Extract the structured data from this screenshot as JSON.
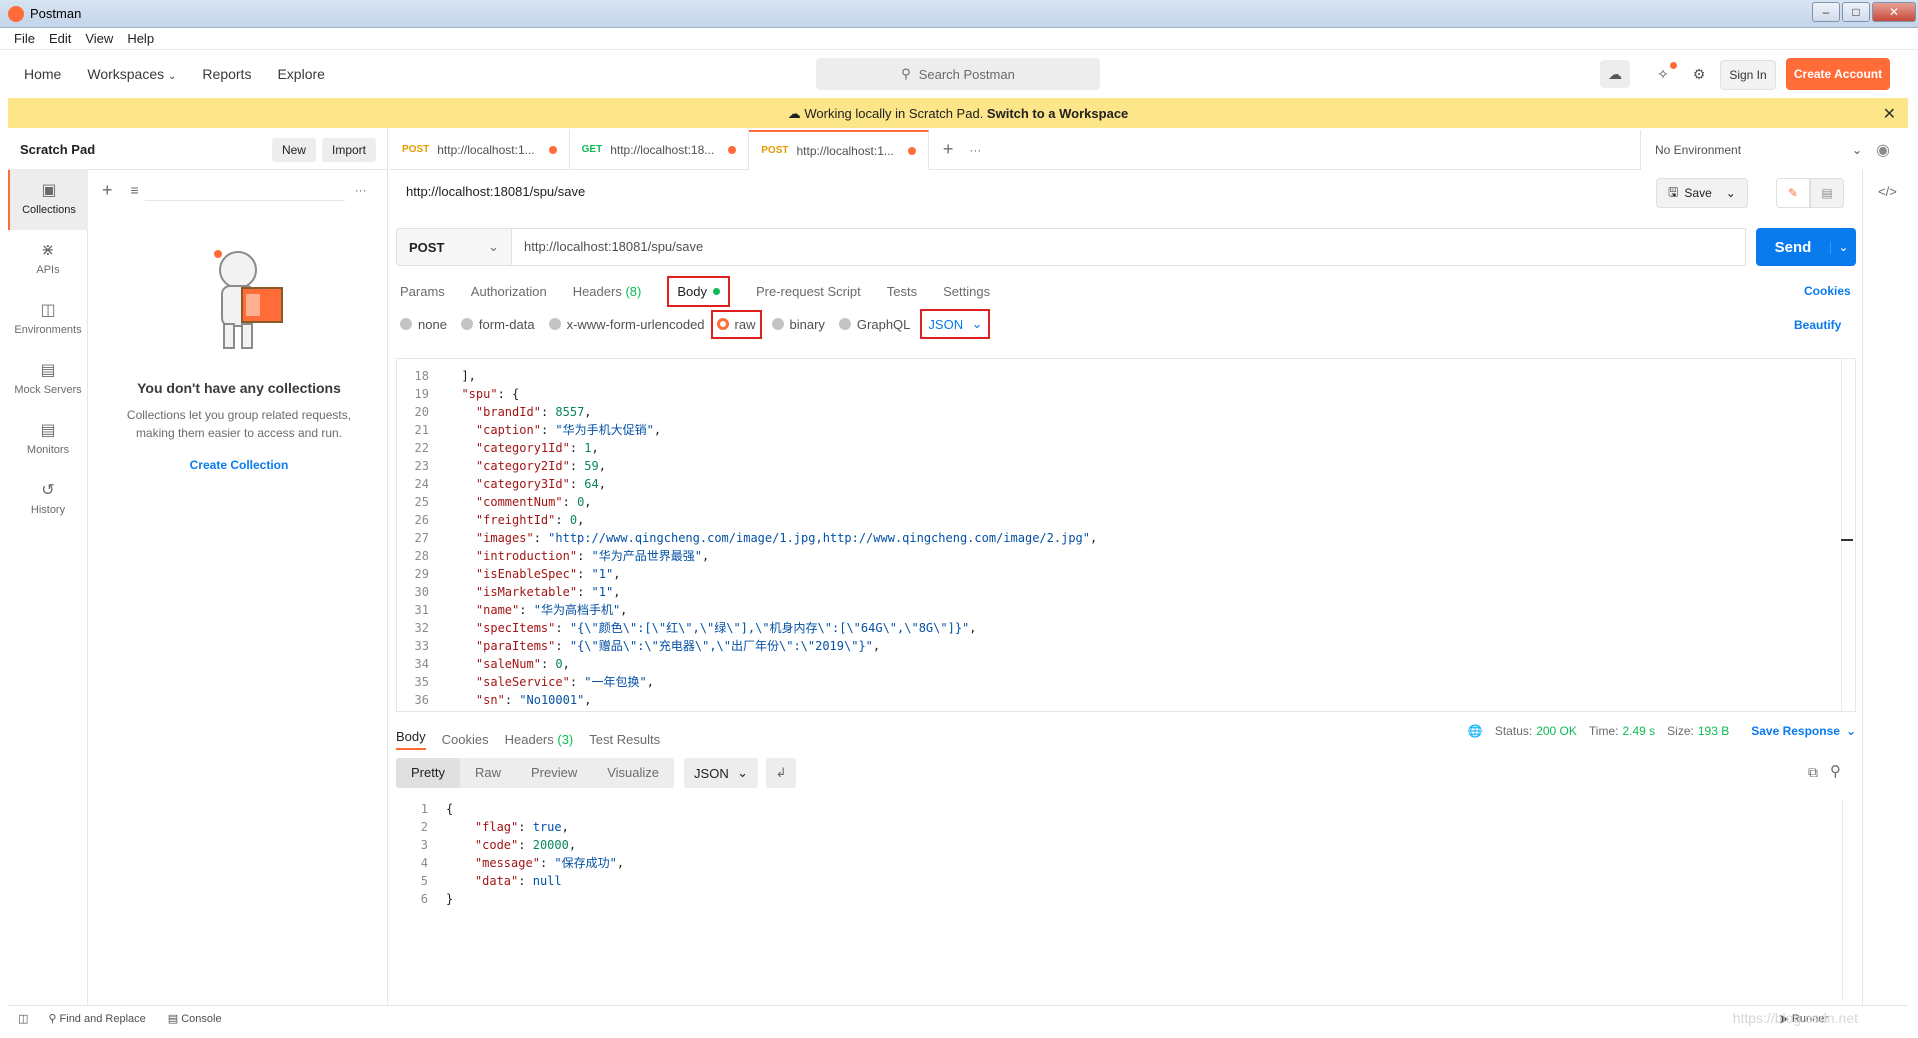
{
  "window": {
    "title": "Postman",
    "min": "–",
    "max": "□",
    "close": "✕"
  },
  "menu": [
    "File",
    "Edit",
    "View",
    "Help"
  ],
  "header": {
    "nav": [
      "Home",
      "Workspaces",
      "Reports",
      "Explore"
    ],
    "search_placeholder": "Search Postman",
    "sign_in": "Sign In",
    "create_account": "Create Account"
  },
  "banner": {
    "text": "Working locally in Scratch Pad.",
    "link": "Switch to a Workspace"
  },
  "sidebar": {
    "title": "Scratch Pad",
    "new": "New",
    "import": "Import",
    "nav": [
      {
        "label": "Collections",
        "icon": "collections-icon"
      },
      {
        "label": "APIs",
        "icon": "apis-icon"
      },
      {
        "label": "Environments",
        "icon": "environments-icon"
      },
      {
        "label": "Mock Servers",
        "icon": "mock-servers-icon"
      },
      {
        "label": "Monitors",
        "icon": "monitors-icon"
      },
      {
        "label": "History",
        "icon": "history-icon"
      }
    ],
    "empty_title": "You don't have any collections",
    "empty_desc1": "Collections let you group related requests,",
    "empty_desc2": "making them easier to access and run.",
    "create_collection": "Create Collection"
  },
  "tabs": [
    {
      "method": "POST",
      "url": "http://localhost:1..."
    },
    {
      "method": "GET",
      "url": "http://localhost:18..."
    },
    {
      "method": "POST",
      "url": "http://localhost:1..."
    }
  ],
  "environment": "No Environment",
  "request": {
    "title": "http://localhost:18081/spu/save",
    "save": "Save",
    "method": "POST",
    "url": "http://localhost:18081/spu/save",
    "send": "Send",
    "tabs": {
      "params": "Params",
      "authorization": "Authorization",
      "headers": "Headers",
      "headers_count": "(8)",
      "body": "Body",
      "pre_request": "Pre-request Script",
      "tests": "Tests",
      "settings": "Settings"
    },
    "cookies": "Cookies",
    "body_types": [
      "none",
      "form-data",
      "x-www-form-urlencoded",
      "raw",
      "binary",
      "GraphQL"
    ],
    "raw_format": "JSON",
    "beautify": "Beautify"
  },
  "code_lines": [
    {
      "n": "18",
      "text": "],",
      "indent": "  "
    },
    {
      "n": "19",
      "key": "\"spu\"",
      "rest": ": {",
      "indent": "  "
    },
    {
      "n": "20",
      "key": "\"brandId\"",
      "val": "8557",
      "type": "n",
      "indent": "    "
    },
    {
      "n": "21",
      "key": "\"caption\"",
      "val": "\"华为手机大促销\"",
      "type": "s",
      "indent": "    "
    },
    {
      "n": "22",
      "key": "\"category1Id\"",
      "val": "1",
      "type": "n",
      "indent": "    "
    },
    {
      "n": "23",
      "key": "\"category2Id\"",
      "val": "59",
      "type": "n",
      "indent": "    "
    },
    {
      "n": "24",
      "key": "\"category3Id\"",
      "val": "64",
      "type": "n",
      "indent": "    "
    },
    {
      "n": "25",
      "key": "\"commentNum\"",
      "val": "0",
      "type": "n",
      "indent": "    "
    },
    {
      "n": "26",
      "key": "\"freightId\"",
      "val": "0",
      "type": "n",
      "indent": "    "
    },
    {
      "n": "27",
      "key": "\"images\"",
      "val": "\"http://www.qingcheng.com/image/1.jpg,http://www.qingcheng.com/image/2.jpg\"",
      "type": "s",
      "indent": "    "
    },
    {
      "n": "28",
      "key": "\"introduction\"",
      "val": "\"华为产品世界最强\"",
      "type": "s",
      "indent": "    "
    },
    {
      "n": "29",
      "key": "\"isEnableSpec\"",
      "val": "\"1\"",
      "type": "s",
      "indent": "    "
    },
    {
      "n": "30",
      "key": "\"isMarketable\"",
      "val": "\"1\"",
      "type": "s",
      "indent": "    "
    },
    {
      "n": "31",
      "key": "\"name\"",
      "val": "\"华为高档手机\"",
      "type": "s",
      "indent": "    "
    },
    {
      "n": "32",
      "key": "\"specItems\"",
      "val": "\"{\\\"颜色\\\":[\\\"红\\\",\\\"绿\\\"],\\\"机身内存\\\":[\\\"64G\\\",\\\"8G\\\"]}\"",
      "type": "s",
      "indent": "    "
    },
    {
      "n": "33",
      "key": "\"paraItems\"",
      "val": "\"{\\\"赠品\\\":\\\"充电器\\\",\\\"出厂年份\\\":\\\"2019\\\"}\"",
      "type": "s",
      "indent": "    "
    },
    {
      "n": "34",
      "key": "\"saleNum\"",
      "val": "0",
      "type": "n",
      "indent": "    "
    },
    {
      "n": "35",
      "key": "\"saleService\"",
      "val": "\"一年包换\"",
      "type": "s",
      "indent": "    "
    },
    {
      "n": "36",
      "key": "\"sn\"",
      "val": "\"No10001\"",
      "type": "s",
      "indent": "    "
    }
  ],
  "response": {
    "tabs": {
      "body": "Body",
      "cookies": "Cookies",
      "headers": "Headers",
      "headers_count": "(3)",
      "test_results": "Test Results"
    },
    "status_label": "Status:",
    "status": "200 OK",
    "time_label": "Time:",
    "time": "2.49 s",
    "size_label": "Size:",
    "size": "193 B",
    "save_response": "Save Response",
    "views": [
      "Pretty",
      "Raw",
      "Preview",
      "Visualize"
    ],
    "format": "JSON",
    "lines": [
      {
        "n": "1",
        "text": "{"
      },
      {
        "n": "2",
        "key": "\"flag\"",
        "val": "true",
        "type": "b"
      },
      {
        "n": "3",
        "key": "\"code\"",
        "val": "20000",
        "type": "n"
      },
      {
        "n": "4",
        "key": "\"message\"",
        "val": "\"保存成功\"",
        "type": "s"
      },
      {
        "n": "5",
        "key": "\"data\"",
        "val": "null",
        "type": "b"
      },
      {
        "n": "6",
        "text": "}"
      }
    ]
  },
  "statusbar": {
    "find_replace": "Find and Replace",
    "console": "Console",
    "runner": "Runner"
  },
  "watermark": "https://blog.csdn.net",
  "colors": {
    "accent": "#ff6c37",
    "send": "#097bed",
    "banner": "#fde68a",
    "highlight_box": "#e02020",
    "status_ok": "#0cbb52"
  }
}
